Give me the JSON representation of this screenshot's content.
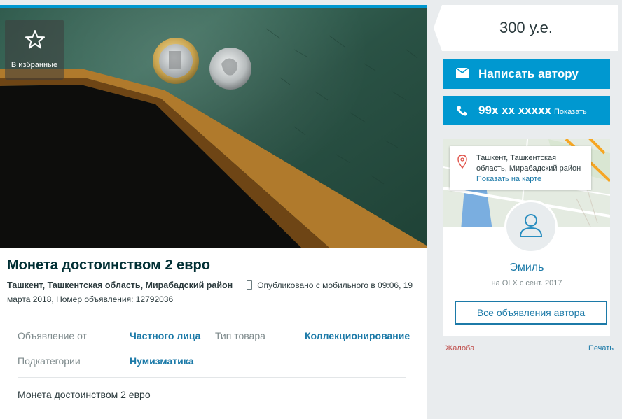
{
  "listing": {
    "favorite_label": "В избранные",
    "title": "Монета достоинством 2 евро",
    "location": "Ташкент, Ташкентская область, Мирабадский район",
    "published": "Опубликовано с мобильного",
    "published_time": "в 09:06, 19 марта 2018, Номер объявления: 12792036",
    "params": [
      {
        "label": "Объявление от",
        "value": "Частного лица"
      },
      {
        "label": "Тип товара",
        "value": "Коллекционирование"
      },
      {
        "label": "Подкатегории",
        "value": "Нумизматика"
      }
    ],
    "description": "Монета достоинством 2 евро"
  },
  "sidebar": {
    "price": "300 у.е.",
    "write_button": "Написать автору",
    "phone": "99x xx xxxxx",
    "phone_show": "Показать",
    "map_address": "Ташкент, Ташкентская область, Мирабадский район",
    "map_link": "Показать на карте",
    "user_name": "Эмиль",
    "user_since": "на OLX с сент. 2017",
    "all_ads_button": "Все объявления автора",
    "report_link": "Жалоба",
    "print_link": "Печать"
  },
  "colors": {
    "accent": "#0098d0",
    "link": "#1c7aa8",
    "report": "#c0504d"
  }
}
